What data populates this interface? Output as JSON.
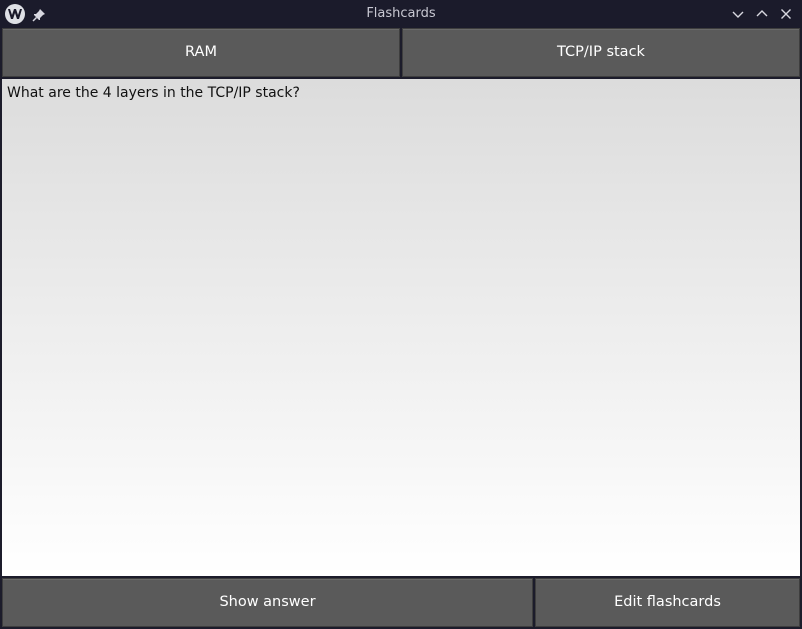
{
  "window": {
    "title": "Flashcards"
  },
  "decks": [
    {
      "label": "RAM"
    },
    {
      "label": "TCP/IP stack"
    }
  ],
  "card": {
    "question": "What are the 4 layers in the TCP/IP stack?"
  },
  "actions": {
    "show_answer_label": "Show answer",
    "edit_flashcards_label": "Edit flashcards"
  },
  "icons": {
    "app": "app-icon",
    "pin": "pin-icon",
    "minimize": "minimize-icon",
    "maximize": "maximize-icon",
    "close": "close-icon"
  }
}
